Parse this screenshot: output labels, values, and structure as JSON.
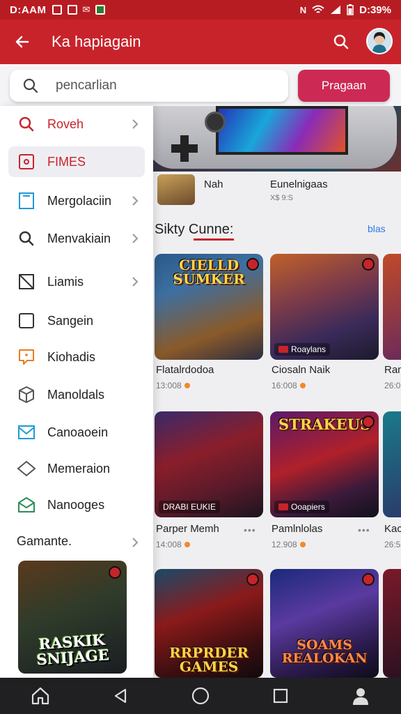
{
  "status_bar": {
    "time": "D:AAM",
    "battery": "D:39%"
  },
  "app_bar": {
    "title": "Ka hapiagain"
  },
  "search": {
    "placeholder": "pencarlian",
    "button_label": "Pragaan"
  },
  "drawer": {
    "items": [
      {
        "label": "Roveh",
        "icon": "search-icon",
        "has_chevron": true,
        "active": false,
        "color": "#c8232b"
      },
      {
        "label": "FIMES",
        "icon": "tag-icon",
        "has_chevron": false,
        "active": true,
        "color": "#c8232b"
      },
      {
        "label": "Mergolaciin",
        "icon": "tablet-icon",
        "has_chevron": true,
        "active": false,
        "color": "#1e9ad6"
      },
      {
        "label": "Menvakiain",
        "icon": "search-icon",
        "has_chevron": true,
        "active": false,
        "color": "#333333"
      },
      {
        "label": "Liamis",
        "icon": "folder-icon",
        "has_chevron": true,
        "active": false,
        "color": "#333333"
      },
      {
        "label": "Sangein",
        "icon": "square-icon",
        "has_chevron": false,
        "active": false,
        "color": "#333333"
      },
      {
        "label": "Kiohadis",
        "icon": "chat-icon",
        "has_chevron": false,
        "active": false,
        "color": "#e67e22"
      },
      {
        "label": "Manoldals",
        "icon": "cube-icon",
        "has_chevron": false,
        "active": false,
        "color": "#555555"
      },
      {
        "label": "Canoaoein",
        "icon": "mail-icon",
        "has_chevron": false,
        "active": false,
        "color": "#1e9ad6"
      },
      {
        "label": "Memeraion",
        "icon": "diamond-icon",
        "has_chevron": false,
        "active": false,
        "color": "#555555"
      },
      {
        "label": "Nanooges",
        "icon": "envelope-icon",
        "has_chevron": false,
        "active": false,
        "color": "#2e8b57"
      }
    ],
    "section_title": "Gamante.",
    "card_title": "RASKIK SNIJAGE"
  },
  "main": {
    "small_row": {
      "name1": "Nah",
      "name2": "Eunelnigaas",
      "meta": "X$ 9:S"
    },
    "section_title": "Sikty Cunne:",
    "section_link": "blas",
    "cards": [
      {
        "art": "CIELLD SUMKER",
        "tag": "",
        "name": "Flatalrdodoa",
        "meta": "13:008",
        "has_more": false
      },
      {
        "art": "",
        "tag": "Roaylans",
        "name": "Ciosaln Naik",
        "meta": "16:008",
        "has_more": false
      },
      {
        "art": "",
        "tag": "",
        "name": "Ran",
        "meta": "26:0",
        "has_more": false
      },
      {
        "art": "",
        "tag": "DRABI EUKIE",
        "name": "Parper Memh",
        "meta": "14:008",
        "has_more": true
      },
      {
        "art": "STRAKEUS",
        "tag": "Ooapiers",
        "name": "Pamlnlolas",
        "meta": "12.908",
        "has_more": true
      },
      {
        "art": "",
        "tag": "",
        "name": "Kac",
        "meta": "26:5",
        "has_more": false
      },
      {
        "art": "RRPRDER GAMES",
        "tag": "",
        "name": "",
        "meta": "",
        "has_more": false
      },
      {
        "art": "SOAMS REALOKAN",
        "tag": "",
        "name": "",
        "meta": "",
        "has_more": false
      }
    ]
  },
  "colors": {
    "primary": "#c8232b",
    "button": "#cc2a55",
    "link": "#2c7be5"
  }
}
